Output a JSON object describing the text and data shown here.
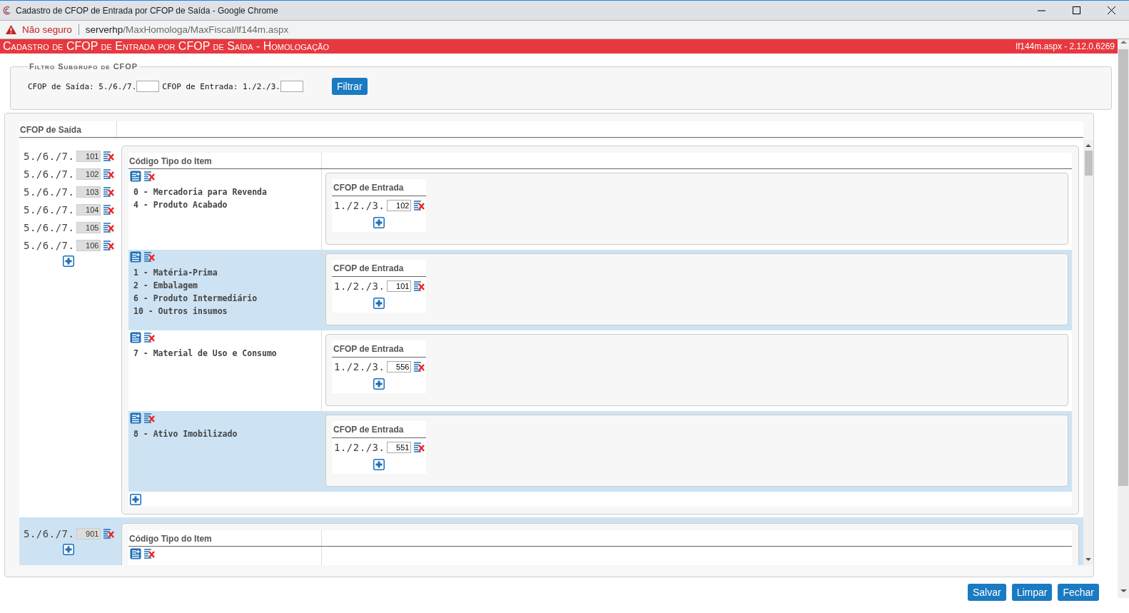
{
  "window": {
    "title": "Cadastro de CFOP de Entrada por CFOP de Saída - Google Chrome"
  },
  "address_bar": {
    "security": "Não seguro",
    "host": "serverhp",
    "path": "/MaxHomologa/MaxFiscal/lf144m.aspx"
  },
  "header": {
    "title": "Cadastro de CFOP de Entrada por CFOP de Saída  - Homologação",
    "version": "lf144m.aspx - 2.12.0.6269"
  },
  "filter": {
    "legend": "Filtro Subgrupo de CFOP",
    "saida_label": "CFOP de Saída: 5./6./7.",
    "entrada_label": "CFOP de Entrada: 1./2./3.",
    "button": "Filtrar"
  },
  "grid": {
    "column": "CFOP de Saída",
    "groups": [
      {
        "saidas": [
          {
            "prefix": "5./6./7.",
            "code": "101"
          },
          {
            "prefix": "5./6./7.",
            "code": "102"
          },
          {
            "prefix": "5./6./7.",
            "code": "103"
          },
          {
            "prefix": "5./6./7.",
            "code": "104"
          },
          {
            "prefix": "5./6./7.",
            "code": "105"
          },
          {
            "prefix": "5./6./7.",
            "code": "106"
          }
        ],
        "tipo_header": "Código Tipo do Item",
        "tipos": [
          {
            "items": [
              "0 - Mercadoria para Revenda",
              "4 - Produto Acabado"
            ],
            "entrada_header": "CFOP de Entrada",
            "entradas": [
              {
                "prefix": "1./2./3.",
                "code": "102"
              }
            ]
          },
          {
            "items": [
              "1 - Matéria-Prima",
              "2 - Embalagem",
              "6 - Produto Intermediário",
              "10 - Outros insumos"
            ],
            "entrada_header": "CFOP de Entrada",
            "entradas": [
              {
                "prefix": "1./2./3.",
                "code": "101"
              }
            ]
          },
          {
            "items": [
              "7 - Material de Uso e Consumo"
            ],
            "entrada_header": "CFOP de Entrada",
            "entradas": [
              {
                "prefix": "1./2./3.",
                "code": "556"
              }
            ]
          },
          {
            "items": [
              "8 - Ativo Imobilizado"
            ],
            "entrada_header": "CFOP de Entrada",
            "entradas": [
              {
                "prefix": "1./2./3.",
                "code": "551"
              }
            ]
          }
        ]
      },
      {
        "saidas": [
          {
            "prefix": "5./6./7.",
            "code": "901"
          }
        ],
        "tipo_header": "Código Tipo do Item"
      }
    ]
  },
  "buttons": [
    "Salvar",
    "Limpar",
    "Fechar"
  ]
}
